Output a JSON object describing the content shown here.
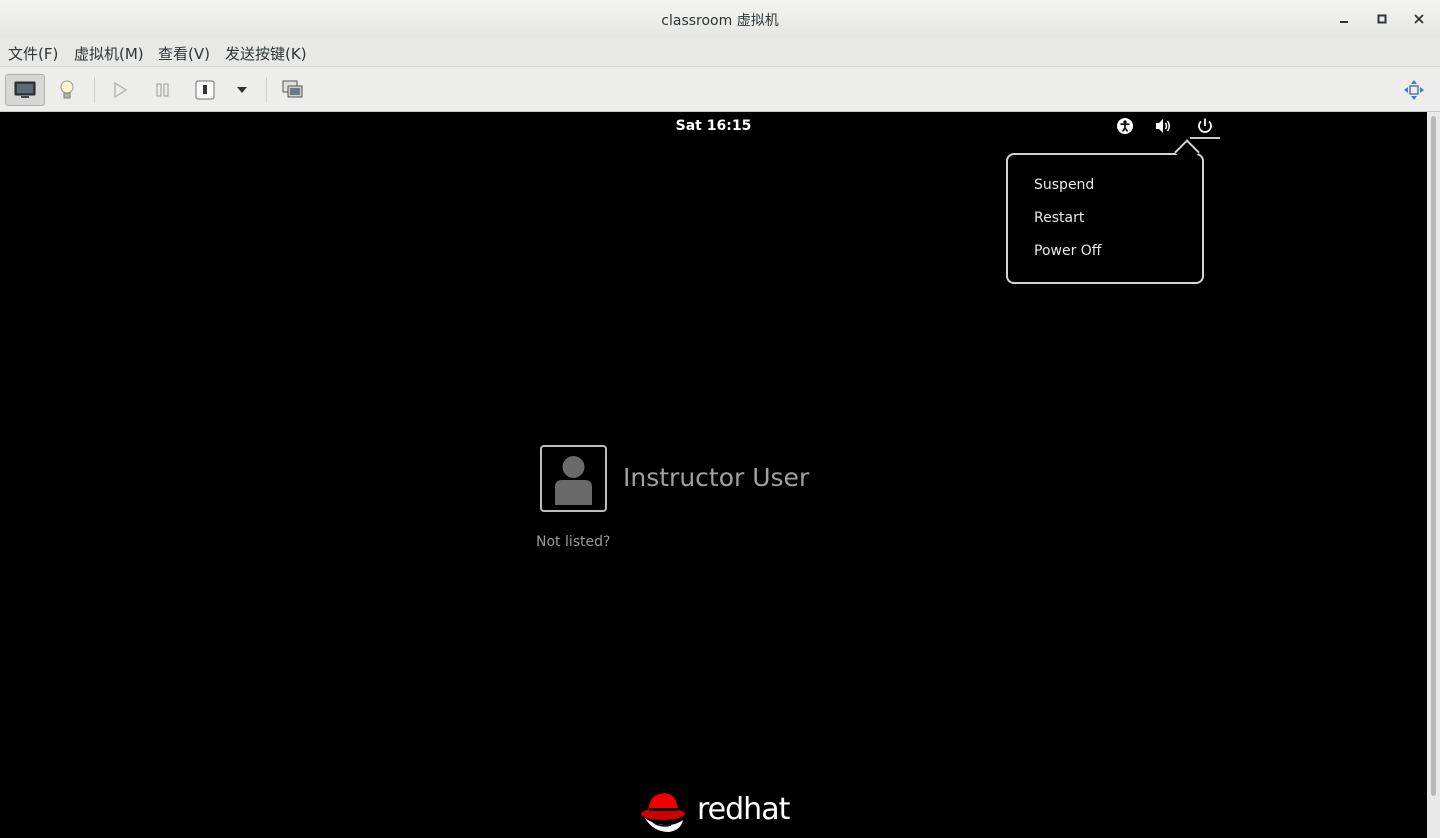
{
  "window": {
    "title": "classroom 虚拟机",
    "controls": {
      "minimize": "–",
      "maximize": "□",
      "close": "✕"
    }
  },
  "menubar": {
    "items": [
      {
        "label": "文件(F)"
      },
      {
        "label": "虚拟机(M)"
      },
      {
        "label": "查看(V)"
      },
      {
        "label": "发送按键(K)"
      }
    ]
  },
  "toolbar": {
    "icons": [
      "console-icon",
      "lightbulb-icon",
      "play-icon",
      "pause-icon",
      "power-icon",
      "dropdown-arrow-icon",
      "snapshot-icon",
      "fullscreen-icon"
    ]
  },
  "vm_screen": {
    "clock": "Sat 16:15",
    "tray_icons": [
      "accessibility-icon",
      "volume-icon",
      "power-icon"
    ],
    "power_menu": {
      "items": [
        {
          "label": "Suspend"
        },
        {
          "label": "Restart"
        },
        {
          "label": "Power Off"
        }
      ]
    },
    "login": {
      "user_name": "Instructor User",
      "not_listed": "Not listed?"
    },
    "logo_text": "redhat",
    "logo_color": "#ee0000"
  }
}
